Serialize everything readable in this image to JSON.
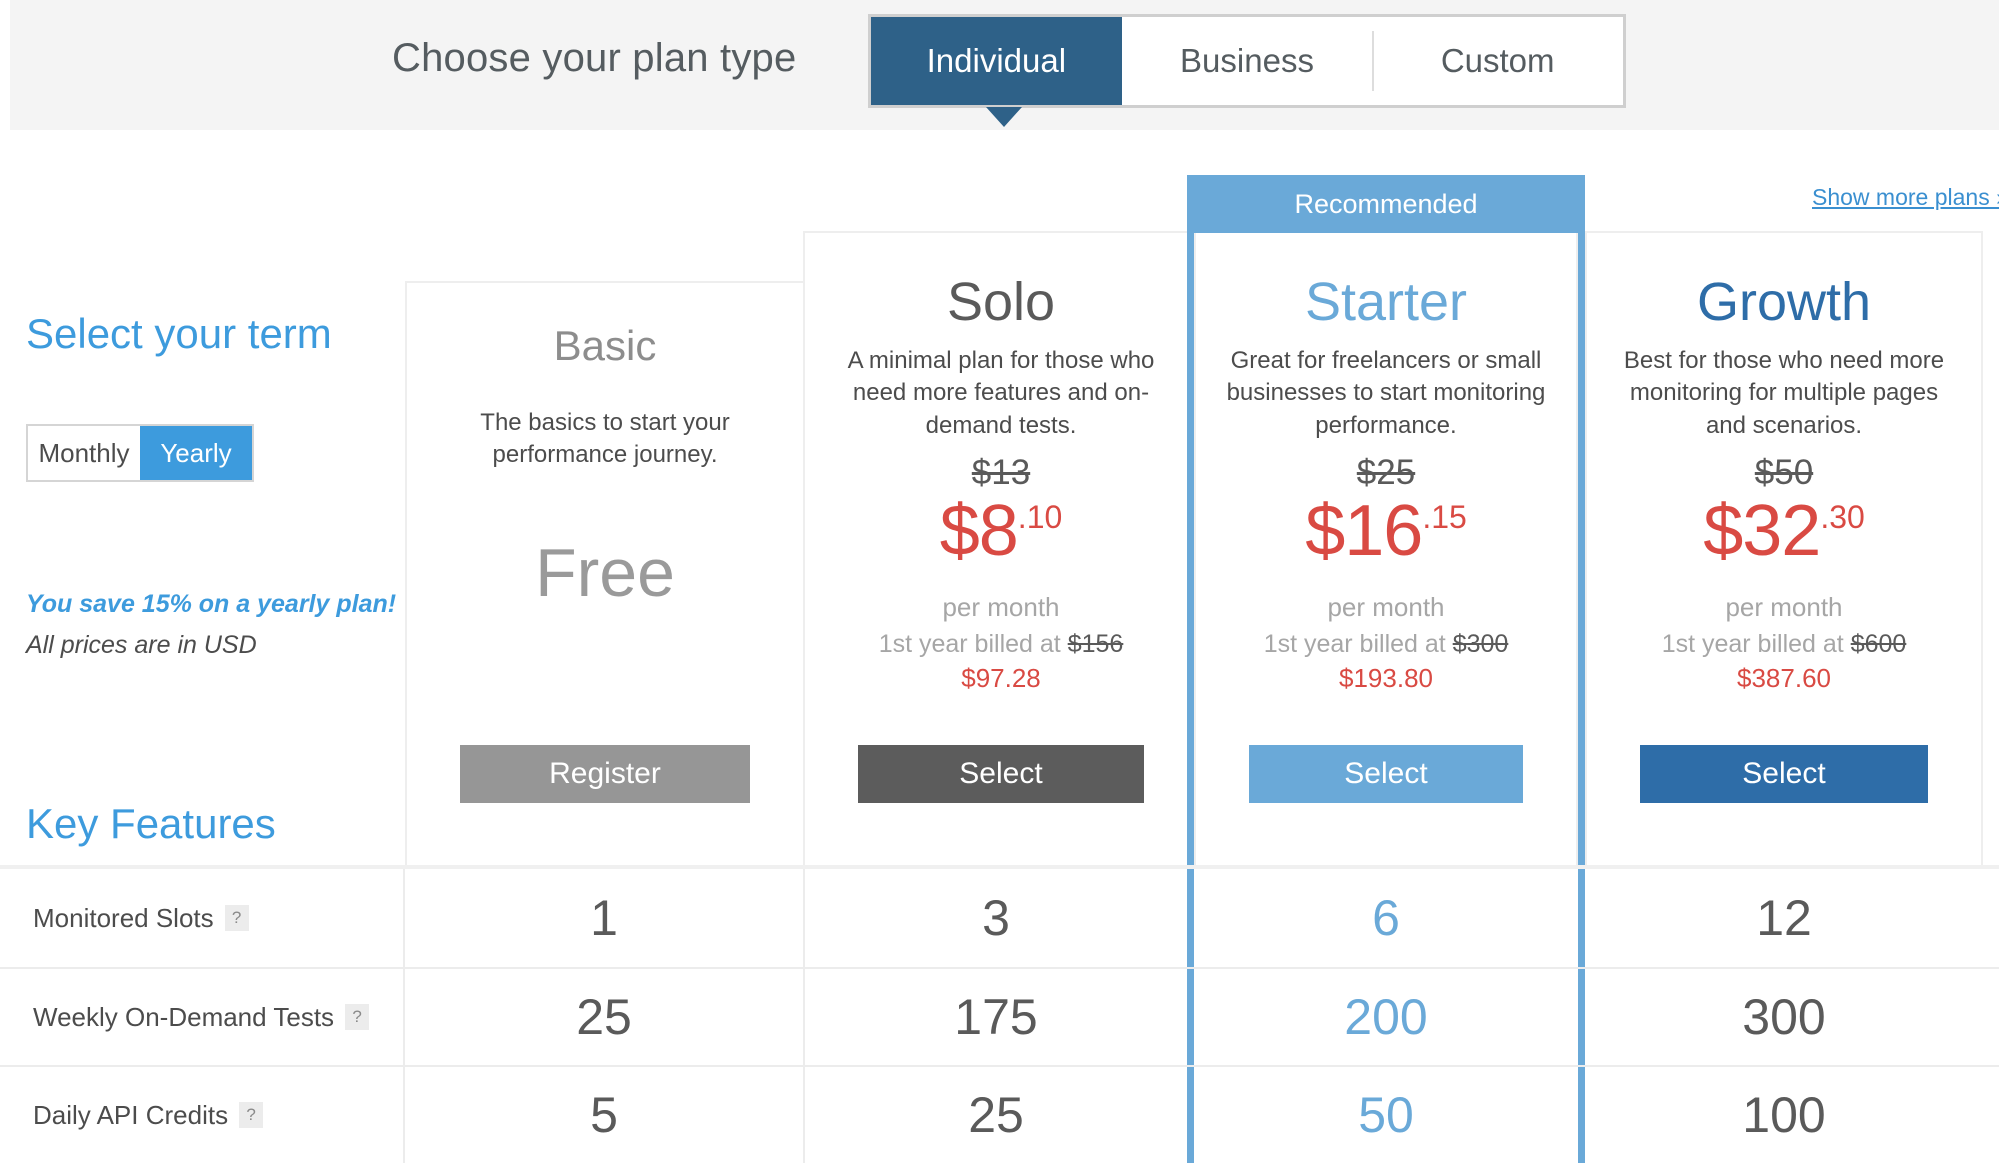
{
  "header": {
    "label": "Choose your plan type",
    "tabs": [
      {
        "label": "Individual",
        "active": true
      },
      {
        "label": "Business",
        "active": false
      },
      {
        "label": "Custom",
        "active": false
      }
    ]
  },
  "sidebar": {
    "term_heading": "Select your term",
    "toggle": {
      "monthly": "Monthly",
      "yearly": "Yearly",
      "selected": "Yearly"
    },
    "save_note": "You save 15% on a yearly plan!",
    "currency_note": "All prices are in USD",
    "features_heading": "Key Features"
  },
  "show_more_plans": "Show more plans ›",
  "plans": [
    {
      "name": "Basic",
      "description": "The basics to start your performance journey.",
      "price_free_label": "Free",
      "cta": "Register"
    },
    {
      "name": "Solo",
      "description": "A minimal plan for those who need more features and on-demand tests.",
      "price_old": "$13",
      "price_currency": "$",
      "price_whole": "8",
      "price_cents": ".10",
      "per_month": "per month",
      "billed_prefix": "1st year billed at ",
      "billed_old": "$156",
      "billed_total": "$97.28",
      "cta": "Select"
    },
    {
      "name": "Starter",
      "badge": "Recommended",
      "description": "Great for freelancers or small businesses to start monitoring performance.",
      "price_old": "$25",
      "price_currency": "$",
      "price_whole": "16",
      "price_cents": ".15",
      "per_month": "per month",
      "billed_prefix": "1st year billed at ",
      "billed_old": "$300",
      "billed_total": "$193.80",
      "cta": "Select"
    },
    {
      "name": "Growth",
      "description": "Best for those who need more monitoring for multiple pages and scenarios.",
      "price_old": "$50",
      "price_currency": "$",
      "price_whole": "32",
      "price_cents": ".30",
      "per_month": "per month",
      "billed_prefix": "1st year billed at ",
      "billed_old": "$600",
      "billed_total": "$387.60",
      "cta": "Select"
    }
  ],
  "features": {
    "help_glyph": "?",
    "rows": [
      {
        "label": "Monitored Slots",
        "values": [
          "1",
          "3",
          "6",
          "12"
        ]
      },
      {
        "label": "Weekly On-Demand Tests",
        "values": [
          "25",
          "175",
          "200",
          "300"
        ]
      },
      {
        "label": "Daily API Credits",
        "values": [
          "5",
          "25",
          "50",
          "100"
        ]
      }
    ]
  },
  "colors": {
    "accent_blue": "#3d9bdd",
    "recommended_blue": "#6aa9d8",
    "growth_blue": "#2e6da8",
    "tab_active": "#2e6188",
    "price_red": "#d94a43",
    "muted_gray": "#a6a6a6"
  }
}
